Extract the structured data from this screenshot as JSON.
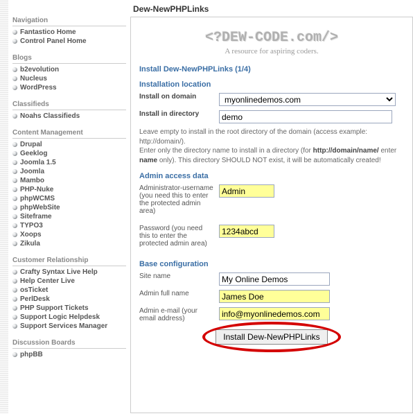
{
  "pageTitle": "Dew-NewPHPLinks",
  "logo": {
    "brand": "<?DEW-CODE.com/>",
    "tagline": "A resource for aspiring coders."
  },
  "installHeading": "Install Dew-NewPHPLinks (1/4)",
  "nav": {
    "groups": [
      {
        "title": "Navigation",
        "items": [
          "Fantastico Home",
          "Control Panel Home"
        ]
      },
      {
        "title": "Blogs",
        "items": [
          "b2evolution",
          "Nucleus",
          "WordPress"
        ]
      },
      {
        "title": "Classifieds",
        "items": [
          "Noahs Classifieds"
        ]
      },
      {
        "title": "Content Management",
        "items": [
          "Drupal",
          "Geeklog",
          "Joomla 1.5",
          "Joomla",
          "Mambo",
          "PHP-Nuke",
          "phpWCMS",
          "phpWebSite",
          "Siteframe",
          "TYPO3",
          "Xoops",
          "Zikula"
        ]
      },
      {
        "title": "Customer Relationship",
        "items": [
          "Crafty Syntax Live Help",
          "Help Center Live",
          "osTicket",
          "PerlDesk",
          "PHP Support Tickets",
          "Support Logic Helpdesk",
          "Support Services Manager"
        ]
      },
      {
        "title": "Discussion Boards",
        "items": [
          "phpBB"
        ]
      }
    ]
  },
  "sections": {
    "location": {
      "heading": "Installation location",
      "domainLabel": "Install on domain",
      "domainValue": "myonlinedemos.com",
      "dirLabel": "Install in directory",
      "dirValue": "demo",
      "help1": "Leave empty to install in the root directory of the domain (access example: http://domain/).",
      "help2a": "Enter only the directory name to install in a directory (for ",
      "help2b": "http://domain/name/",
      "help2c": " enter ",
      "help2d": "name",
      "help2e": " only). This directory SHOULD NOT exist, it will be automatically created!"
    },
    "admin": {
      "heading": "Admin access data",
      "userLabel": "Administrator-username (you need this to enter the protected admin area)",
      "userValue": "Admin",
      "passLabel": "Password (you need this to enter the protected admin area)",
      "passValue": "1234abcd"
    },
    "base": {
      "heading": "Base configuration",
      "siteLabel": "Site name",
      "siteValue": "My Online Demos",
      "nameLabel": "Admin full name",
      "nameValue": "James Doe",
      "emailLabel": "Admin e-mail (your email address)",
      "emailValue": "info@myonlinedemos.com"
    }
  },
  "installButton": "Install Dew-NewPHPLinks"
}
